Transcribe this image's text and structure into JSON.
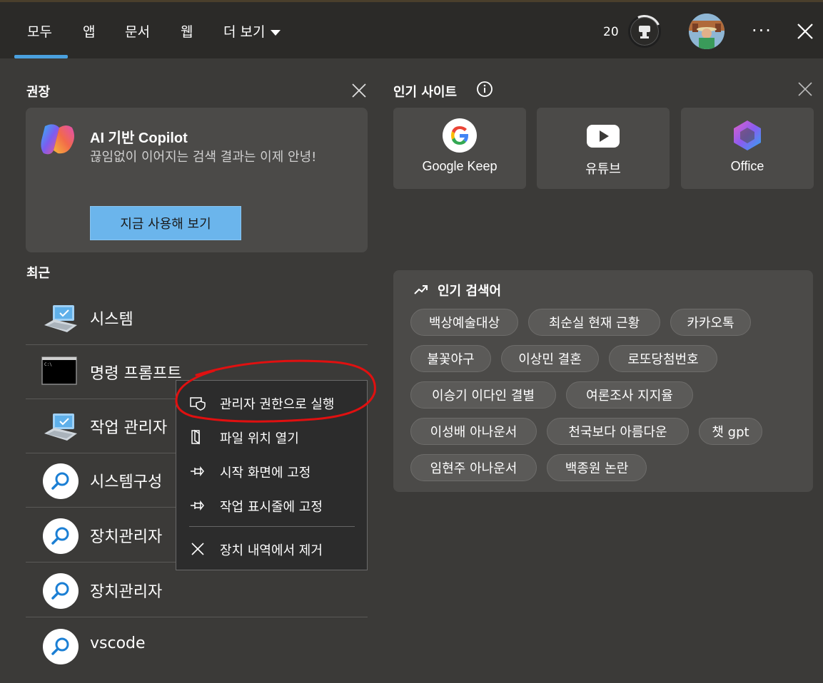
{
  "tabs": [
    {
      "label": "모두"
    },
    {
      "label": "앱"
    },
    {
      "label": "문서"
    },
    {
      "label": "웹"
    },
    {
      "label": "더 보기"
    }
  ],
  "header": {
    "points": "20",
    "icons": [
      "reward-icon",
      "avatar",
      "more-options-icon",
      "close-icon"
    ]
  },
  "recommended": {
    "title": "권장",
    "copilot": {
      "title": "AI 기반 Copilot",
      "description": "끊임없이 이어지는 검색 결과는 이제 안녕!",
      "button": "지금 사용해 보기"
    }
  },
  "recent": {
    "title": "최근",
    "items": [
      {
        "label": "시스템",
        "icon": "computer-icon"
      },
      {
        "label": "명령 프롬프트",
        "icon": "terminal-icon"
      },
      {
        "label": "작업 관리자",
        "icon": "computer-icon"
      },
      {
        "label": "시스템구성",
        "icon": "search-icon"
      },
      {
        "label": "장치관리자",
        "icon": "search-icon"
      },
      {
        "label": "장치관리자",
        "icon": "search-icon"
      },
      {
        "label": "vscode",
        "icon": "search-icon"
      }
    ]
  },
  "top_sites": {
    "title": "인기 사이트",
    "sites": [
      {
        "label": "Google Keep",
        "icon": "google-icon"
      },
      {
        "label": "유튜브",
        "icon": "youtube-icon"
      },
      {
        "label": "Office",
        "icon": "office-icon"
      }
    ]
  },
  "trending": {
    "title": "인기 검색어",
    "chips": [
      "백상예술대상",
      "최순실 현재 근황",
      "카카오톡",
      "불꽃야구",
      "이상민 결혼",
      "로또당첨번호",
      "이승기 이다인 결별",
      "여론조사 지지율",
      "이성배 아나운서",
      "천국보다 아름다운",
      "챗 gpt",
      "임현주 아나운서",
      "백종원 논란"
    ]
  },
  "context_menu": {
    "items": [
      {
        "label": "관리자 권한으로 실행",
        "icon": "shield-icon"
      },
      {
        "label": "파일 위치 열기",
        "icon": "folder-icon"
      },
      {
        "label": "시작 화면에 고정",
        "icon": "pin-icon"
      },
      {
        "label": "작업 표시줄에 고정",
        "icon": "pin-icon"
      },
      {
        "label": "장치 내역에서 제거",
        "icon": "close-icon"
      }
    ]
  },
  "colors": {
    "background": "#3b3a38",
    "topbar": "#2b2a28",
    "card": "#4b4a48",
    "accent": "#4aa0de",
    "button": "#6bb5ec",
    "annotation": "#e01010"
  }
}
